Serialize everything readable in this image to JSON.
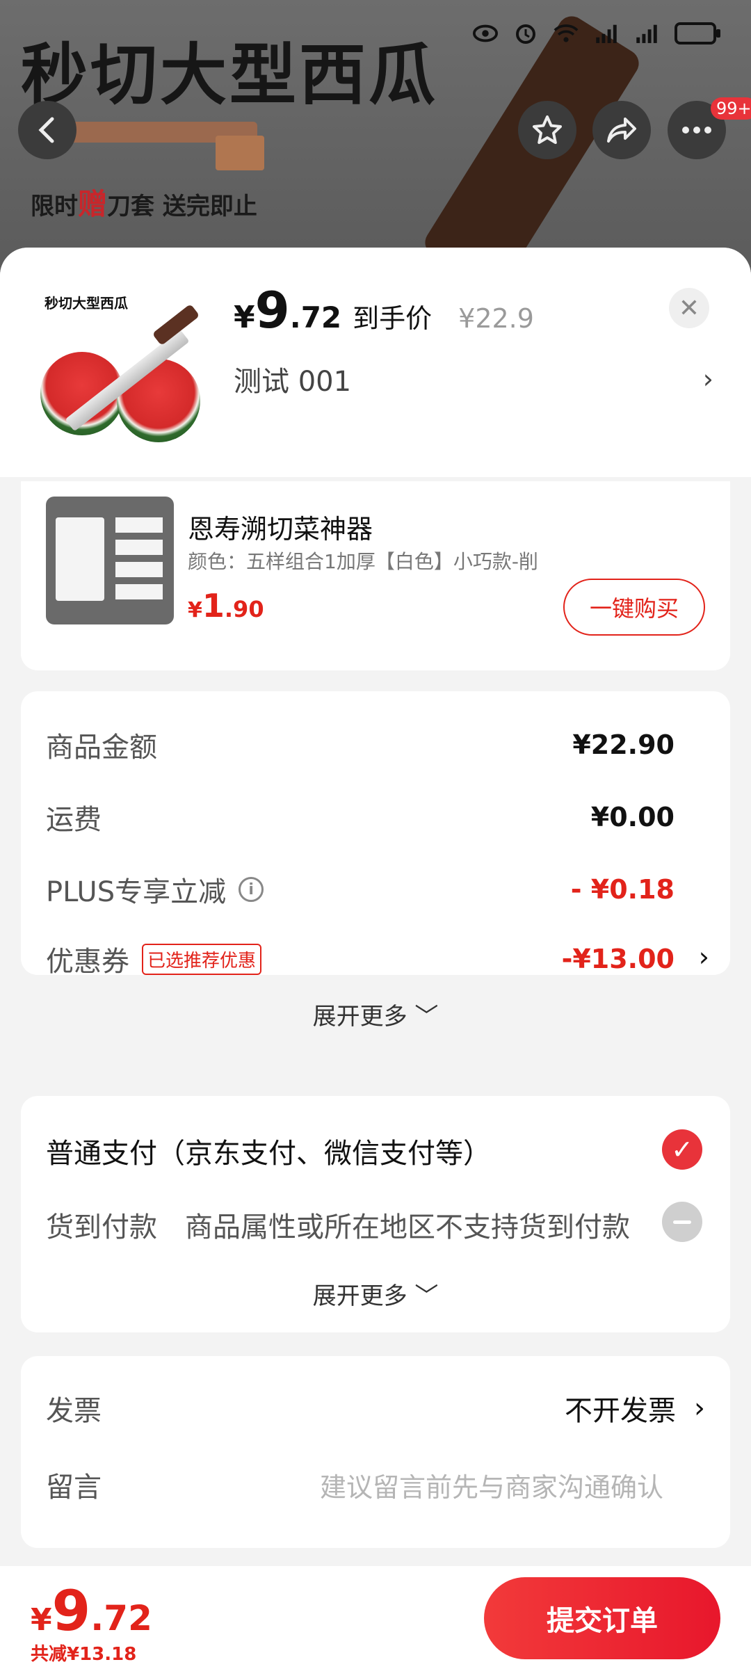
{
  "background": {
    "product_title": "秒切大型西瓜",
    "promo_prefix": "限时",
    "promo_highlight": "赠",
    "promo_suffix": "刀套 送完即止",
    "more_badge": "99+"
  },
  "product": {
    "image_caption": "秒切大型西瓜",
    "price_symbol": "¥",
    "price_int": "9",
    "price_dec": ".72",
    "price_label": "到手价",
    "original_price": "¥22.9",
    "spec": "测试  001"
  },
  "recommend": {
    "title": "恩寿溯切菜神器",
    "spec": "颜色：五样组合1加厚【白色】小巧款-削",
    "price_symbol": "¥",
    "price_int": "1",
    "price_dec": ".90",
    "buy_label": "一键购买"
  },
  "amounts": {
    "items": [
      {
        "label": "商品金额",
        "value": "¥22.90"
      },
      {
        "label": "运费",
        "value": "¥0.00"
      },
      {
        "label": "PLUS专享立减",
        "value": "- ¥0.18"
      },
      {
        "label": "优惠券",
        "tag": "已选推荐优惠",
        "value": "-¥13.00"
      }
    ],
    "expand_label": "展开更多 ﹀"
  },
  "payment": {
    "main_option": "普通支付（京东支付、微信支付等）",
    "cod_label": "货到付款",
    "cod_desc": "商品属性或所在地区不支持货到付款",
    "expand_label": "展开更多 ﹀"
  },
  "invoice": {
    "label": "发票",
    "value": "不开发票",
    "note_label": "留言",
    "note_placeholder": "建议留言前先与商家沟通确认"
  },
  "footer": {
    "price_symbol": "¥",
    "price_int": "9",
    "price_dec": ".72",
    "savings": "共减¥13.18",
    "submit_label": "提交订单"
  },
  "colors": {
    "accent": "#e2231a",
    "submit_gradient_start": "#f23a3a",
    "submit_gradient_end": "#e8172c"
  }
}
